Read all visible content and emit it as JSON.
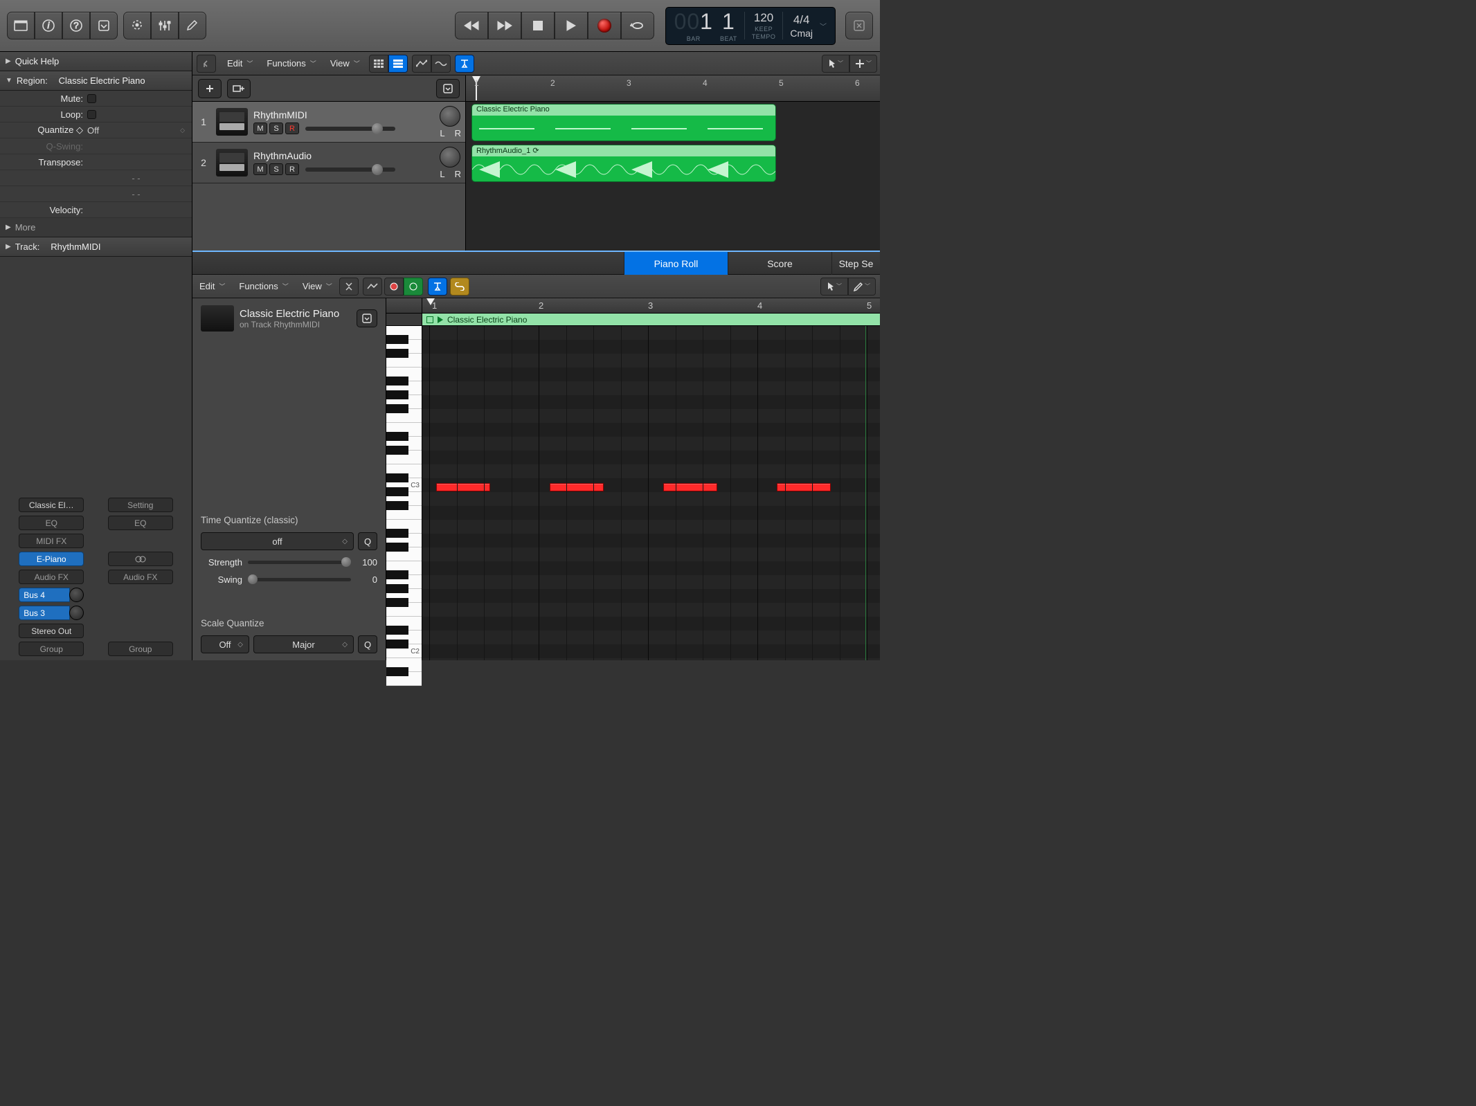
{
  "transport": {
    "bar_ghost": "00",
    "bar": "1",
    "beat": "1",
    "bar_lbl": "BAR",
    "beat_lbl": "BEAT",
    "tempo": "120",
    "tempo_lbl": "KEEP",
    "tempo_sub": "TEMPO",
    "sig": "4/4",
    "key": "Cmaj"
  },
  "inspector": {
    "quickhelp": "Quick Help",
    "region_prefix": "Region:",
    "region_name": "Classic Electric Piano",
    "params": [
      {
        "l": "Mute:",
        "v": ""
      },
      {
        "l": "Loop:",
        "v": ""
      },
      {
        "l": "Quantize ◇",
        "v": "Off"
      },
      {
        "l": "Q-Swing:",
        "v": ""
      },
      {
        "l": "Transpose:",
        "v": ""
      },
      {
        "l": "",
        "v": "- -"
      },
      {
        "l": "",
        "v": "- -"
      },
      {
        "l": "Velocity:",
        "v": ""
      }
    ],
    "more": "More",
    "track_prefix": "Track:",
    "track_name": "RhythmMIDI",
    "strip1": {
      "inst": "Classic El…",
      "eq": "EQ",
      "midifx": "MIDI FX",
      "plug": "E-Piano",
      "afx": "Audio FX",
      "bus1": "Bus 4",
      "bus2": "Bus 3",
      "out": "Stereo Out",
      "grp": "Group"
    },
    "strip2": {
      "setting": "Setting",
      "eq": "EQ",
      "afx": "Audio FX",
      "grp": "Group"
    }
  },
  "arrange": {
    "menus": [
      "Edit",
      "Functions",
      "View"
    ],
    "ruler": [
      1,
      2,
      3,
      4,
      5,
      6
    ]
  },
  "tracks": [
    {
      "n": "1",
      "name": "RhythmMIDI",
      "m": "M",
      "s": "S",
      "r": "R",
      "rec": true
    },
    {
      "n": "2",
      "name": "RhythmAudio",
      "m": "M",
      "s": "S",
      "r": "R",
      "rec": false
    }
  ],
  "regions": [
    {
      "name": "Classic Electric Piano",
      "type": "midi"
    },
    {
      "name": "RhythmAudio_1 ⟳",
      "type": "audio"
    }
  ],
  "editor": {
    "tabs": [
      "Piano Roll",
      "Score",
      "Step Se"
    ],
    "menus": [
      "Edit",
      "Functions",
      "View"
    ],
    "region_title": "Classic Electric Piano",
    "region_sub": "on Track RhythmMIDI",
    "ruler": [
      1,
      2,
      3,
      4,
      5
    ],
    "region_bar": "Classic Electric Piano",
    "tq_label": "Time Quantize (classic)",
    "tq_value": "off",
    "strength_l": "Strength",
    "strength_v": "100",
    "swing_l": "Swing",
    "swing_v": "0",
    "sq_label": "Scale Quantize",
    "sq_off": "Off",
    "sq_scale": "Major",
    "oct_c3": "C3",
    "oct_c2": "C2",
    "q_btn": "Q"
  }
}
